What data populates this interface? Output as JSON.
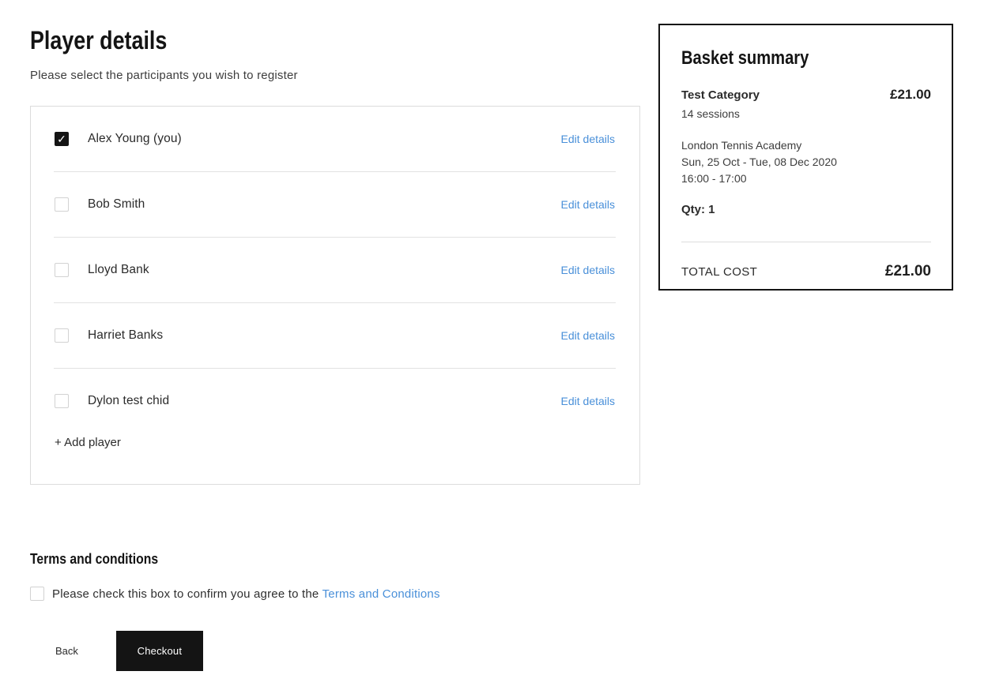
{
  "page": {
    "title": "Player details",
    "subtitle": "Please select the participants you wish to register"
  },
  "players": [
    {
      "name": "Alex Young (you)",
      "checked": true,
      "edit_label": "Edit details"
    },
    {
      "name": "Bob Smith",
      "checked": false,
      "edit_label": "Edit details"
    },
    {
      "name": "Lloyd Bank",
      "checked": false,
      "edit_label": "Edit details"
    },
    {
      "name": "Harriet Banks",
      "checked": false,
      "edit_label": "Edit details"
    },
    {
      "name": "Dylon test chid",
      "checked": false,
      "edit_label": "Edit details"
    }
  ],
  "add_player_label": "+ Add player",
  "check_glyph": "✓",
  "basket": {
    "title": "Basket summary",
    "item_name": "Test Category",
    "item_price": "£21.00",
    "sessions": "14 sessions",
    "venue": "London Tennis Academy",
    "dates": "Sun, 25 Oct - Tue, 08 Dec 2020",
    "time": "16:00 - 17:00",
    "qty": "Qty: 1",
    "total_label": "TOTAL COST",
    "total_value": "£21.00"
  },
  "terms": {
    "title": "Terms and conditions",
    "checkbox_text": "Please check this box to confirm you agree to the",
    "link_text": "Terms and Conditions",
    "checked": false
  },
  "actions": {
    "back_label": "Back",
    "checkout_label": "Checkout"
  },
  "colors": {
    "link_blue": "#4a90d9",
    "button_black": "#141414",
    "border_gray": "#dcdcdc"
  }
}
